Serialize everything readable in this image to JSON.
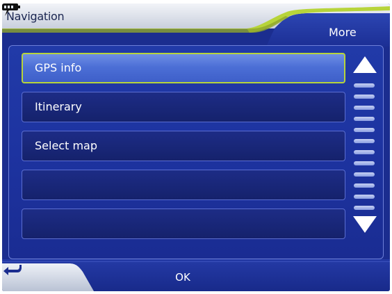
{
  "header": {
    "title": "Navigation",
    "more_label": "More",
    "icons": [
      "bolt-icon",
      "battery-icon"
    ]
  },
  "menu": {
    "items": [
      {
        "label": "GPS info",
        "selected": true
      },
      {
        "label": "Itinerary",
        "selected": false
      },
      {
        "label": "Select map",
        "selected": false
      },
      {
        "label": "",
        "selected": false
      },
      {
        "label": "",
        "selected": false
      }
    ]
  },
  "scrollbar": {
    "icons": [
      "arrow-up-icon",
      "arrow-down-icon"
    ]
  },
  "footer": {
    "ok_label": "OK",
    "back_icon": "return-arrow-icon"
  },
  "colors": {
    "background": "#1b2d8f",
    "header": "#dde3ee",
    "accent_green": "#b7d43a",
    "selected_item": "#4c6fd6"
  }
}
